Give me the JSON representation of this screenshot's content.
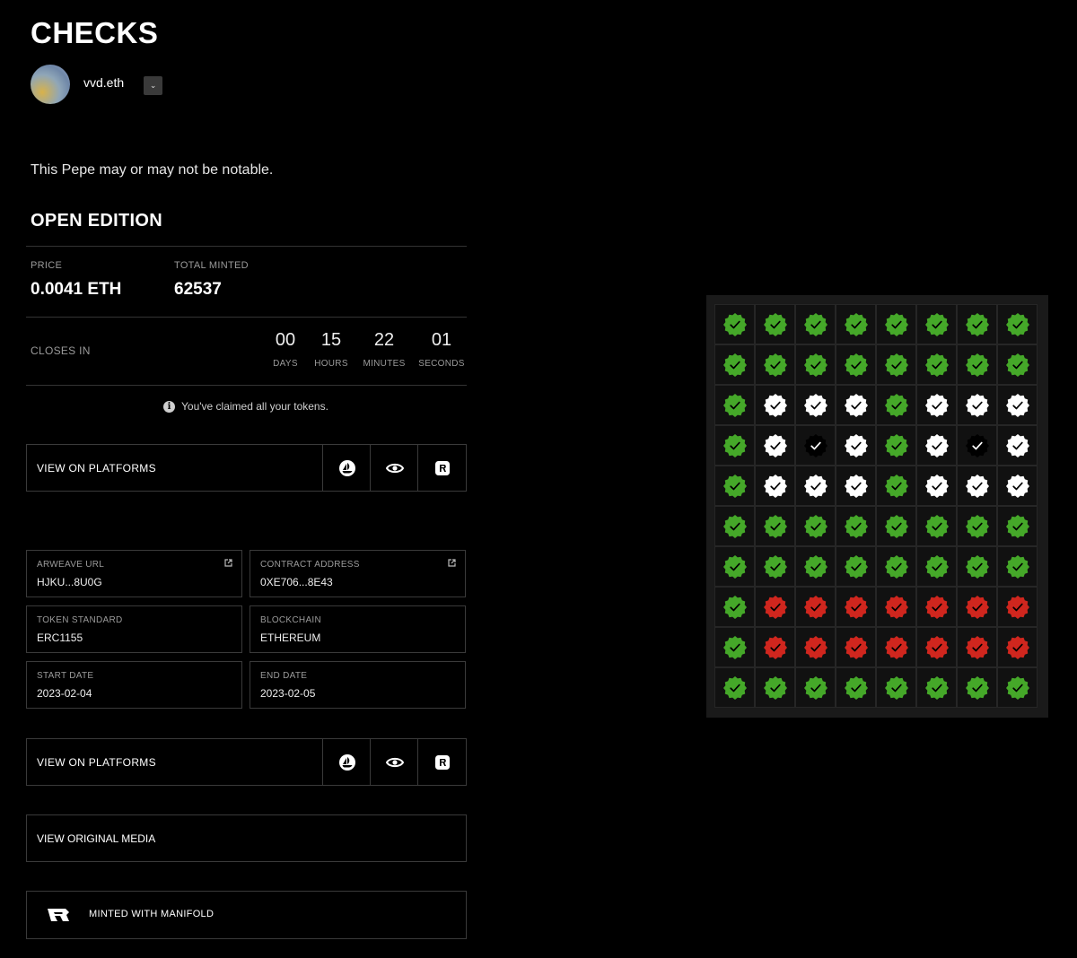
{
  "title": "CHECKS",
  "creator": {
    "name": "vvd.eth"
  },
  "description": "This Pepe may or may not be notable.",
  "edition": "OPEN EDITION",
  "stats": {
    "price_label": "PRICE",
    "price": "0.0041 ETH",
    "minted_label": "TOTAL MINTED",
    "minted": "62537"
  },
  "countdown": {
    "label": "CLOSES IN",
    "items": [
      {
        "value": "00",
        "unit": "DAYS"
      },
      {
        "value": "15",
        "unit": "HOURS"
      },
      {
        "value": "22",
        "unit": "MINUTES"
      },
      {
        "value": "01",
        "unit": "SECONDS"
      }
    ]
  },
  "claimed_notice": "You've claimed all your tokens.",
  "platforms": {
    "label": "VIEW ON PLATFORMS",
    "icons": [
      "opensea-icon",
      "eye-icon",
      "rarible-icon"
    ]
  },
  "details": {
    "arweave": {
      "label": "ARWEAVE URL",
      "value": "HJKU...8U0G"
    },
    "contract": {
      "label": "CONTRACT ADDRESS",
      "value": "0XE706...8E43"
    },
    "standard": {
      "label": "TOKEN STANDARD",
      "value": "ERC1155"
    },
    "blockchain": {
      "label": "BLOCKCHAIN",
      "value": "ETHEREUM"
    },
    "start": {
      "label": "START DATE",
      "value": "2023-02-04"
    },
    "end": {
      "label": "END DATE",
      "value": "2023-02-05"
    }
  },
  "media_link": "VIEW ORIGINAL MEDIA",
  "manifold": "MINTED WITH MANIFOLD",
  "colors": {
    "green": "#45a829",
    "white": "#ffffff",
    "black": "#000000",
    "red": "#d0261e"
  },
  "artwork_grid": [
    [
      "green",
      "green",
      "green",
      "green",
      "green",
      "green",
      "green",
      "green"
    ],
    [
      "green",
      "green",
      "green",
      "green",
      "green",
      "green",
      "green",
      "green"
    ],
    [
      "green",
      "white",
      "white",
      "white",
      "green",
      "white",
      "white",
      "white"
    ],
    [
      "green",
      "white",
      "black",
      "white",
      "green",
      "white",
      "black",
      "white"
    ],
    [
      "green",
      "white",
      "white",
      "white",
      "green",
      "white",
      "white",
      "white"
    ],
    [
      "green",
      "green",
      "green",
      "green",
      "green",
      "green",
      "green",
      "green"
    ],
    [
      "green",
      "green",
      "green",
      "green",
      "green",
      "green",
      "green",
      "green"
    ],
    [
      "green",
      "red",
      "red",
      "red",
      "red",
      "red",
      "red",
      "red"
    ],
    [
      "green",
      "red",
      "red",
      "red",
      "red",
      "red",
      "red",
      "red"
    ],
    [
      "green",
      "green",
      "green",
      "green",
      "green",
      "green",
      "green",
      "green"
    ]
  ]
}
